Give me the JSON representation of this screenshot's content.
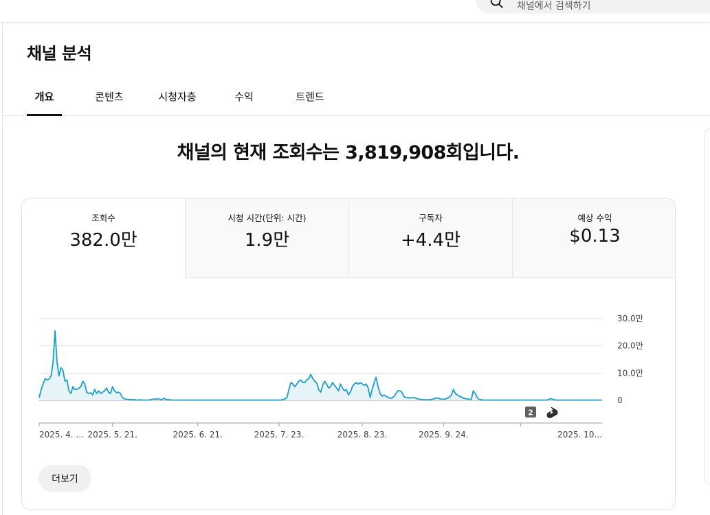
{
  "search": {
    "placeholder": "채널에서 검색하기"
  },
  "page_title": "채널 분석",
  "tabs": [
    {
      "label": "개요",
      "active": true
    },
    {
      "label": "콘텐츠"
    },
    {
      "label": "시청자층"
    },
    {
      "label": "수익"
    },
    {
      "label": "트렌드"
    }
  ],
  "headline": "채널의 현재 조회수는 3,819,908회입니다.",
  "metrics": [
    {
      "label": "조회수",
      "value": "382.0만"
    },
    {
      "label": "시청 시간(단위: 시간)",
      "value": "1.9만"
    },
    {
      "label": "구독자",
      "value": "+4.4만"
    },
    {
      "label": "예상 수익",
      "value": "$0.13"
    }
  ],
  "chart_data": {
    "type": "area",
    "series": [
      {
        "values": [
          1.0,
          4.0,
          6.0,
          8.0,
          7.5,
          7.8,
          9.0,
          14.0,
          25.5,
          14.0,
          9.0,
          12.0,
          11.0,
          7.0,
          7.5,
          3.5,
          2.5,
          5.0,
          4.0,
          4.0,
          4.5,
          5.0,
          7.0,
          6.0,
          3.0,
          2.5,
          2.8,
          2.0,
          4.0,
          2.5,
          3.5,
          2.5,
          3.0,
          3.5,
          4.5,
          3.0,
          2.5,
          5.0,
          3.5,
          2.8,
          3.0,
          2.5,
          1.0,
          0.5,
          0.4,
          0.3,
          0.3,
          0.2,
          0.3,
          0.1,
          0.1,
          0.2,
          0.1,
          0.1,
          0.1,
          0.1,
          0.2,
          0.3,
          0.5,
          0.4,
          0.6,
          0.3,
          0.2,
          0.8,
          0.3,
          0.2,
          0.2,
          0.1,
          0.1,
          0.1,
          0.1,
          0.1,
          0.1,
          0.1,
          0.1,
          0.1,
          0.1,
          0.1,
          0.1,
          0.1,
          0.1,
          0.1,
          0.1,
          0.1,
          0.1,
          0.1,
          0.1,
          0.1,
          0.1,
          0.1,
          0.1,
          0.1,
          0.1,
          0.1,
          0.1,
          0.1,
          0.1,
          0.1,
          0.1,
          0.1,
          0.1,
          0.1,
          0.1,
          0.1,
          0.1,
          0.1,
          0.1,
          0.1,
          0.1,
          0.1,
          0.1,
          0.1,
          0.1,
          0.1,
          0.1,
          0.1,
          0.1,
          0.1,
          0.1,
          0.1,
          0.1,
          0.1,
          0.1,
          0.3,
          0.5,
          1.0,
          4.0,
          6.5,
          6.0,
          5.0,
          6.0,
          7.0,
          7.5,
          6.5,
          6.5,
          7.5,
          8.0,
          9.5,
          8.0,
          7.0,
          6.5,
          4.0,
          3.0,
          5.5,
          7.0,
          6.0,
          4.5,
          5.0,
          6.5,
          5.5,
          4.5,
          3.5,
          6.0,
          4.5,
          3.5,
          4.0,
          2.0,
          3.0,
          5.0,
          6.0,
          6.5,
          6.0,
          6.5,
          6.0,
          5.5,
          6.0,
          4.5,
          1.0,
          4.0,
          6.5,
          8.5,
          5.0,
          2.5,
          1.5,
          2.0,
          1.5,
          1.0,
          0.8,
          0.8,
          1.5,
          2.5,
          3.5,
          3.5,
          3.0,
          1.5,
          1.0,
          1.0,
          0.8,
          1.0,
          1.0,
          0.8,
          0.5,
          0.4,
          0.3,
          0.2,
          0.2,
          0.2,
          0.2,
          0.3,
          0.5,
          0.8,
          0.8,
          0.6,
          0.4,
          0.4,
          0.5,
          0.8,
          1.2,
          2.0,
          4.0,
          2.5,
          2.0,
          1.5,
          1.2,
          0.8,
          0.6,
          0.5,
          0.4,
          0.3,
          3.5,
          2.5,
          1.0,
          0.3,
          0.2,
          0.1,
          0.1,
          0.1,
          0.1,
          0.1,
          0.1,
          0.1,
          0.1,
          0.1,
          0.1,
          0.1,
          0.1,
          0.1,
          0.1,
          0.1,
          0.1,
          0.1,
          0.1,
          0.1,
          0.1,
          0.1,
          0.1,
          0.1,
          0.1,
          0.1,
          0.1,
          0.1,
          0.1,
          0.1,
          0.1,
          0.1,
          0.1,
          0.1,
          0.3,
          0.6,
          0.4,
          0.2,
          0.1,
          0.1,
          0.1,
          0.1,
          0.1,
          0.1,
          0.1,
          0.1,
          0.1,
          0.1,
          0.1,
          0.1,
          0.1,
          0.1,
          0.1,
          0.1,
          0.1,
          0.1,
          0.1,
          0.1,
          0.1,
          0.1,
          0.1,
          0.1
        ]
      }
    ],
    "y_unit": "만",
    "ylim": [
      0,
      30
    ],
    "yticks": [
      "30.0만",
      "20.0만",
      "10.0만",
      "0"
    ],
    "ytick_values": [
      30,
      20,
      10,
      0
    ],
    "xticks": [
      "2025. 4. ...",
      "2025. 5. 21.",
      "2025. 6. 21.",
      "2025. 7. 23.",
      "2025. 8. 23.",
      "2025. 9. 24.",
      "2025. 10..."
    ],
    "xtick_positions": [
      0,
      37,
      80,
      121,
      163,
      204,
      243
    ],
    "marker_badge": "2",
    "colors": {
      "line": "#1c9dc9",
      "fill": "#e6f4fa",
      "grid": "#e0e0e0"
    },
    "grid": true,
    "legend": "none"
  },
  "more_button_label": "더보기"
}
